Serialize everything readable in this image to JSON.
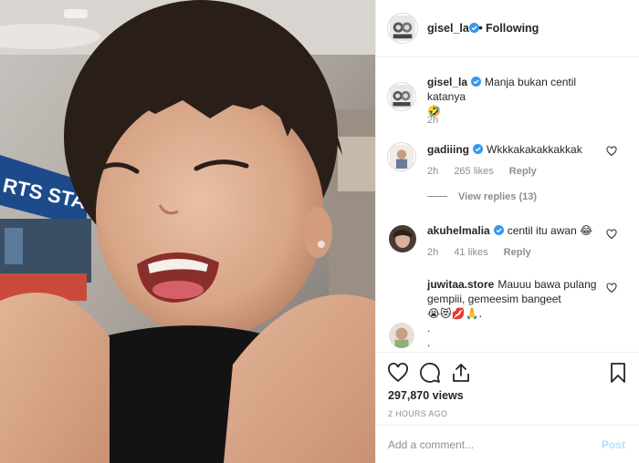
{
  "colors": {
    "text": "#262626",
    "muted": "#8e8e8e",
    "verified": "#3897f0",
    "post_disabled": "#b2dffc",
    "border": "#efefef"
  },
  "post": {
    "username": "gisel_la",
    "follow_separator": "•",
    "follow_label": "Following",
    "caption": {
      "username": "gisel_la",
      "text": "Manja bukan centil katanya",
      "emoji": "🤣",
      "time": "2h"
    }
  },
  "comments": [
    {
      "username": "gadiiing",
      "verified": true,
      "text": "Wkkkakakakkakkak",
      "time": "2h",
      "likes": "265 likes",
      "reply": "Reply",
      "view_replies": "View replies (13)"
    },
    {
      "username": "akuhelmalia",
      "verified": true,
      "text": "centil itu awan",
      "emoji": "😂",
      "time": "2h",
      "likes": "41 likes",
      "reply": "Reply"
    },
    {
      "username": "juwitaa.store",
      "verified": false,
      "text": "Mauuu bawa pulang gempiii, gemeesim bangeet",
      "emoji": "😭😻💋🙏.",
      "line2": ".",
      "line3": "."
    }
  ],
  "actions": {
    "like_icon": "heart-icon",
    "comment_icon": "comment-icon",
    "share_icon": "share-icon",
    "save_icon": "bookmark-icon"
  },
  "stats": {
    "views": "297,870 views",
    "time_ago": "2 HOURS AGO"
  },
  "add_comment": {
    "placeholder": "Add a comment...",
    "post_label": "Post"
  },
  "media": {
    "sign_text": "RTS STA"
  }
}
